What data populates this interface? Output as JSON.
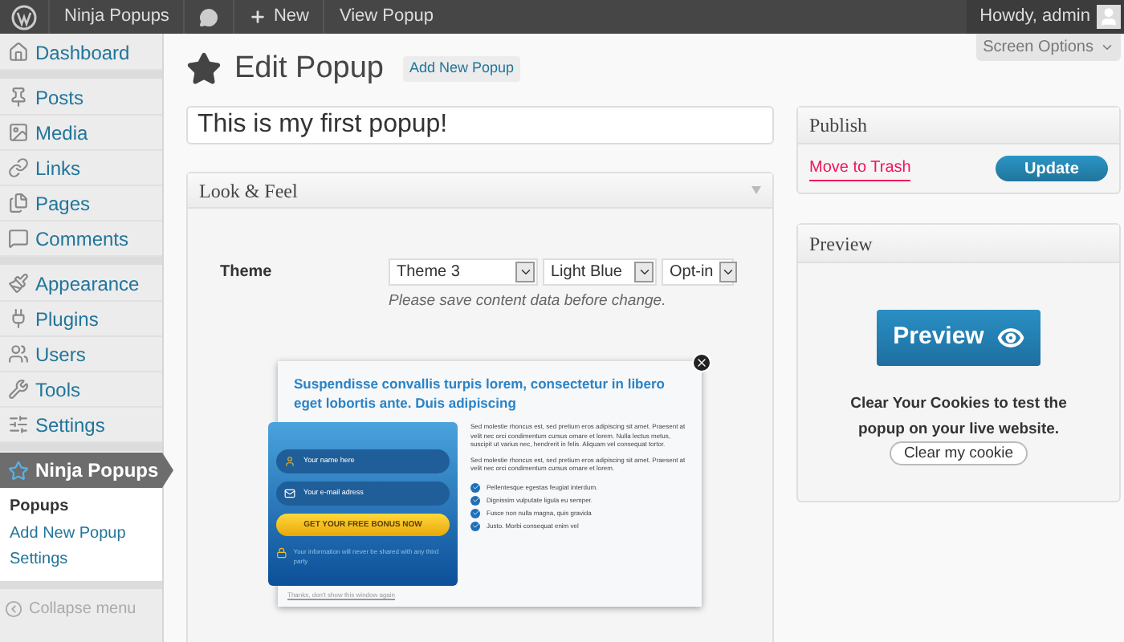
{
  "admin_bar": {
    "site": "Ninja Popups",
    "new": "New",
    "view": "View Popup",
    "greeting": "Howdy, admin"
  },
  "screen_options": "Screen Options",
  "menu": [
    [
      {
        "label": "Dashboard",
        "selected": false
      }
    ],
    [
      {
        "label": "Posts",
        "selected": false
      },
      {
        "label": "Media",
        "selected": false
      },
      {
        "label": "Links",
        "selected": false
      },
      {
        "label": "Pages",
        "selected": false
      },
      {
        "label": "Comments",
        "selected": false
      }
    ],
    [
      {
        "label": "Appearance",
        "selected": false
      },
      {
        "label": "Plugins",
        "selected": false
      },
      {
        "label": "Users",
        "selected": false
      },
      {
        "label": "Tools",
        "selected": false
      },
      {
        "label": "Settings",
        "selected": false
      }
    ],
    [
      {
        "label": "Ninja Popups",
        "selected": true,
        "children": [
          {
            "label": "Popups",
            "selected": true
          },
          {
            "label": "Add New Popup",
            "selected": false
          },
          {
            "label": "Settings",
            "selected": false
          }
        ]
      }
    ]
  ],
  "collapse": "Collapse menu",
  "page": {
    "title": "Edit Popup",
    "add_new": "Add New Popup",
    "post_title": "This is my first popup!"
  },
  "look_feel": {
    "title": "Look & Feel",
    "theme_label": "Theme",
    "selects": [
      "Theme 3",
      "Light Blue",
      "Opt-in"
    ],
    "note": "Please save content data before change.",
    "popup": {
      "heading": "Suspendisse convallis turpis lorem, consectetur in libero eget lobortis ante. Duis adipiscing",
      "name_placeholder": "Your name here",
      "email_placeholder": "Your e-mail adress",
      "cta": "GET YOUR FREE BONUS NOW",
      "privacy": "Your information will never be shared with any third party",
      "paragraphs": [
        "Sed molestie rhoncus est, sed pretium eros adipiscing sit amet. Praesent at velit nec orci condimentum cursus ornare et lorem. Nulla lectus metus, suscipit ut varius nec, hendrerit in felis. Aliquam vel consequat tortor.",
        "Sed molestie rhoncus est, sed pretium eros adipiscing sit amet. Praesent at velit nec orci condimentum cursus ornare et lorem."
      ],
      "bullets": [
        "Pellentesque egestas feugiat interdum.",
        "Dignissim vulputate ligula eu semper.",
        "Fusce non nulla magna, quis gravida",
        "Justo. Morbi consequat enim vel"
      ],
      "dismiss": "Thanks, don't show this window again"
    }
  },
  "publish": {
    "title": "Publish",
    "trash": "Move to Trash",
    "update": "Update"
  },
  "preview": {
    "title": "Preview",
    "button": "Preview",
    "note": "Clear Your Cookies to test the popup on your live website.",
    "clear": "Clear my cookie"
  }
}
